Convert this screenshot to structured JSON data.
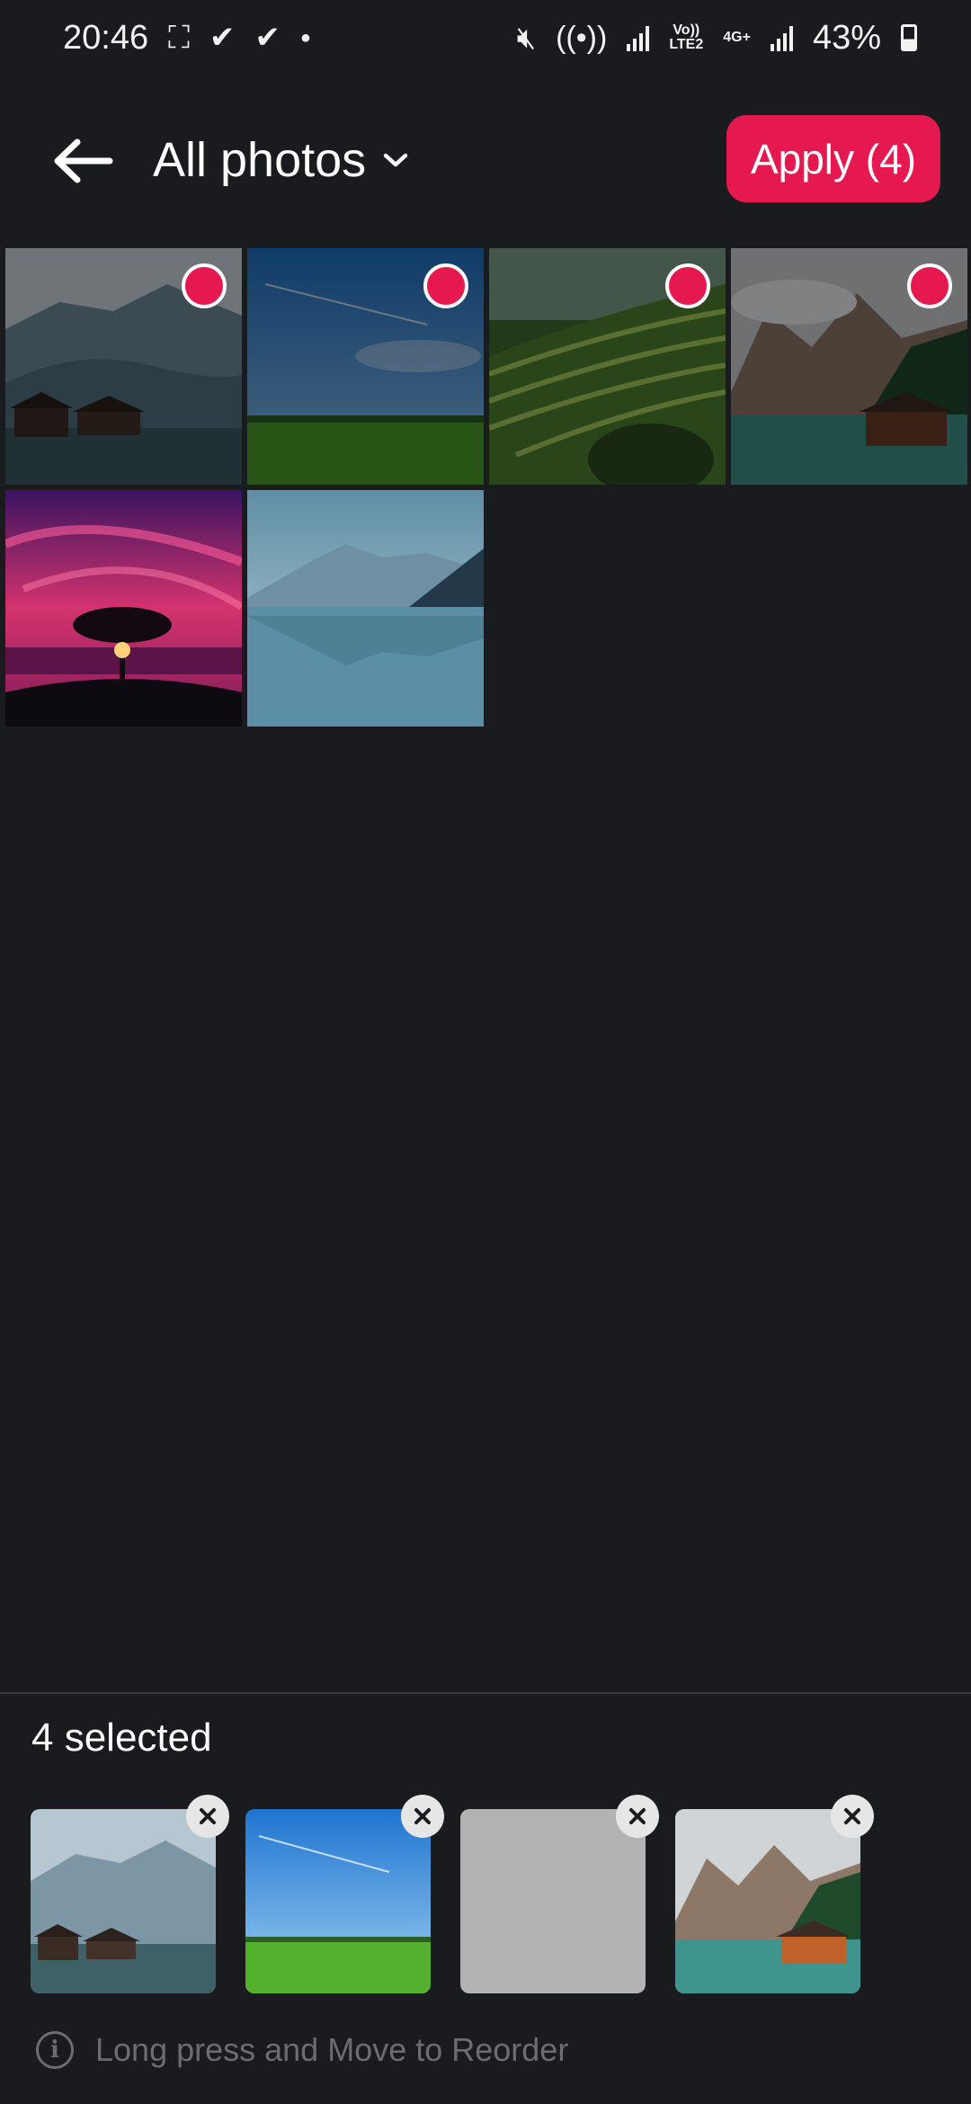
{
  "status_bar": {
    "time": "20:46",
    "battery": "43%",
    "volte_label": "Vo))",
    "lte_label": "LTE2",
    "network_label": "4G+"
  },
  "header": {
    "album_title": "All photos",
    "apply_label": "Apply (4)"
  },
  "grid": {
    "photos": [
      {
        "name": "lake-huts",
        "selected": true
      },
      {
        "name": "green-field-blue-sky",
        "selected": true
      },
      {
        "name": "rice-terraces",
        "selected": true
      },
      {
        "name": "mountain-lake-boathouse",
        "selected": true
      },
      {
        "name": "tree-pink-sunset",
        "selected": false
      },
      {
        "name": "mountain-lake-reflection",
        "selected": false
      }
    ]
  },
  "bottom": {
    "selected_text": "4 selected",
    "hint_text": "Long press and Move to Reorder",
    "selected_items": [
      "lake-huts",
      "green-field-blue-sky",
      "placeholder-gray",
      "mountain-lake-boathouse"
    ]
  },
  "colors": {
    "accent": "#e5194f",
    "background": "#1a1b1f",
    "hint": "#6c6d72"
  }
}
